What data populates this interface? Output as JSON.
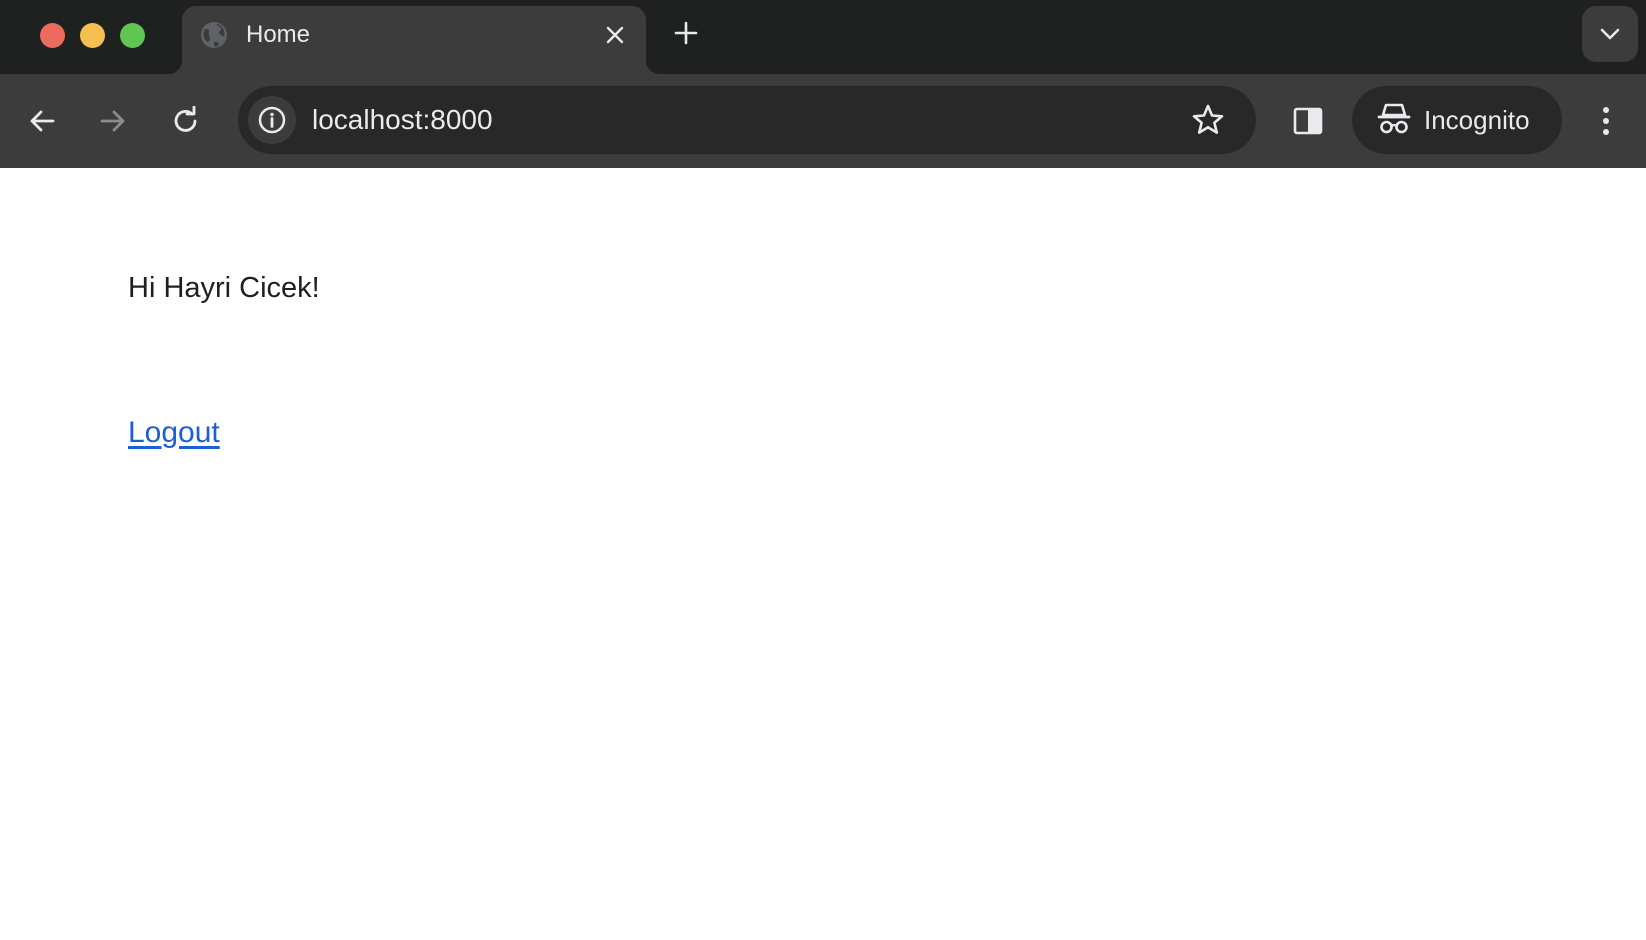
{
  "browser": {
    "tab": {
      "title": "Home",
      "favicon": "globe-icon"
    },
    "toolbar": {
      "url": "localhost:8000",
      "profile_label": "Incognito"
    },
    "colors": {
      "traffic_close": "#ed6a5e",
      "traffic_minimize": "#f5bf4f",
      "traffic_maximize": "#61c554",
      "chrome_dark": "#1f2020",
      "toolbar_bg": "#3c3c3c",
      "omnibox_bg": "#282828"
    }
  },
  "page": {
    "greeting": "Hi Hayri Cicek!",
    "logout_label": "Logout",
    "link_color": "#1a5fd6"
  }
}
